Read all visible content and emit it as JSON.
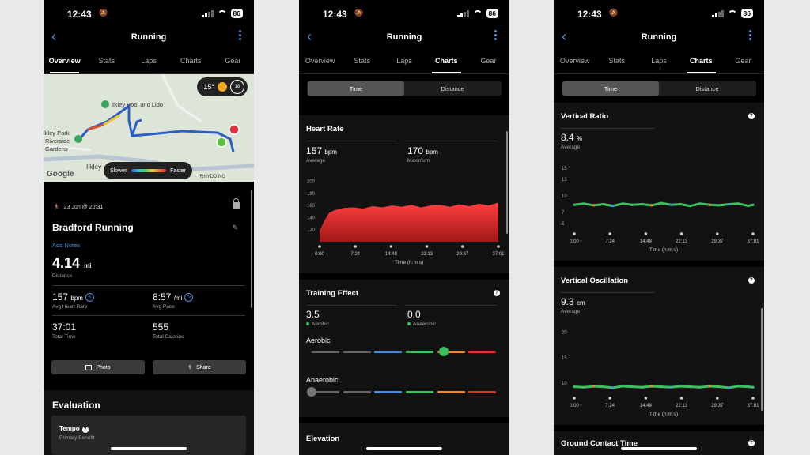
{
  "status": {
    "time": "12:43",
    "battery": "86"
  },
  "nav": {
    "title": "Running"
  },
  "tabs": [
    "Overview",
    "Stats",
    "Laps",
    "Charts",
    "Gear"
  ],
  "overview": {
    "map": {
      "weather_temp": "15°",
      "weather_badge": "18",
      "places": [
        "Ilkley Pool and Lido",
        "lkley Park",
        "Riverside",
        "Gardens",
        "Ilkley",
        "RHYDDING"
      ],
      "legend_slow": "Slower",
      "legend_fast": "Faster",
      "attribution": "Google"
    },
    "activity_date": "23 Jun @ 20:31",
    "activity_name": "Bradford Running",
    "add_notes": "Add Notes",
    "distance": {
      "value": "4.14",
      "unit": "mi",
      "label": "Distance"
    },
    "avg_hr": {
      "value": "157",
      "unit": "bpm",
      "label": "Avg Heart Rate"
    },
    "avg_pace": {
      "value": "8:57",
      "unit": "/mi",
      "label": "Avg Pace"
    },
    "total_time": {
      "value": "37:01",
      "label": "Total Time"
    },
    "total_calories": {
      "value": "555",
      "label": "Total Calories"
    },
    "photo_button": "Photo",
    "share_button": "Share",
    "evaluation": {
      "title": "Evaluation",
      "benefit": "Tempo",
      "benefit_label": "Primary Benefit"
    }
  },
  "charts_segment": {
    "time": "Time",
    "distance": "Distance"
  },
  "heart_rate": {
    "title": "Heart Rate",
    "average": {
      "value": "157",
      "unit": "bpm",
      "label": "Average"
    },
    "maximum": {
      "value": "170",
      "unit": "bpm",
      "label": "Maximum"
    }
  },
  "training_effect": {
    "title": "Training Effect",
    "aerobic": {
      "value": "3.5",
      "label": "Aerobic"
    },
    "anaerobic": {
      "value": "0.0",
      "label": "Anaerobic"
    },
    "aerobic_heading": "Aerobic",
    "anaerobic_heading": "Anaerobic",
    "scale_colors": [
      "#666666",
      "#666666",
      "#4a8fe0",
      "#3cc060",
      "#f08a30",
      "#e03030"
    ]
  },
  "elevation": {
    "title": "Elevation"
  },
  "vertical_ratio": {
    "title": "Vertical Ratio",
    "value": "8.4",
    "unit": "%",
    "label": "Average"
  },
  "vertical_oscillation": {
    "title": "Vertical Oscillation",
    "value": "9.3",
    "unit": "cm",
    "label": "Average"
  },
  "ground_contact": {
    "title": "Ground Contact Time"
  },
  "chart_data": [
    {
      "type": "area",
      "title": "Heart Rate",
      "xlabel": "Time (h:m:s)",
      "x_ticks": [
        "0:00",
        "7:24",
        "14:48",
        "22:13",
        "29:37",
        "37:01"
      ],
      "y_ticks": [
        120,
        140,
        160,
        180,
        200
      ],
      "ylim": [
        100,
        210
      ],
      "x": [
        0,
        1,
        2,
        3,
        5,
        7,
        9,
        11,
        13,
        15,
        17,
        19,
        21,
        23,
        25,
        27,
        29,
        31,
        33,
        35,
        37
      ],
      "values": [
        118,
        135,
        148,
        152,
        156,
        157,
        155,
        159,
        157,
        160,
        158,
        161,
        157,
        160,
        161,
        158,
        162,
        159,
        163,
        160,
        165
      ],
      "color": "#e03030"
    },
    {
      "type": "scatter",
      "title": "Vertical Ratio",
      "xlabel": "Time (h:m:s)",
      "x_ticks": [
        "0:00",
        "7:24",
        "14:48",
        "22:13",
        "29:37",
        "37:01"
      ],
      "y_ticks": [
        5,
        7,
        10,
        13,
        15
      ],
      "ylim": [
        4,
        16
      ],
      "x": [
        0,
        2,
        4,
        6,
        8,
        10,
        12,
        14,
        16,
        18,
        20,
        22,
        24,
        26,
        28,
        30,
        32,
        34,
        36,
        37
      ],
      "values": [
        8.4,
        8.6,
        8.3,
        8.5,
        8.2,
        8.6,
        8.4,
        8.5,
        8.3,
        8.7,
        8.4,
        8.5,
        8.2,
        8.6,
        8.4,
        8.3,
        8.5,
        8.6,
        8.2,
        8.4
      ]
    },
    {
      "type": "scatter",
      "title": "Vertical Oscillation",
      "xlabel": "Time (h:m:s)",
      "x_ticks": [
        "0:00",
        "7:24",
        "14:48",
        "22:13",
        "29:37",
        "37:01"
      ],
      "y_ticks": [
        10,
        15,
        20
      ],
      "ylim": [
        8,
        21
      ],
      "x": [
        0,
        2,
        4,
        6,
        8,
        10,
        12,
        14,
        16,
        18,
        20,
        22,
        24,
        26,
        28,
        30,
        32,
        34,
        36,
        37
      ],
      "values": [
        9.3,
        9.2,
        9.4,
        9.3,
        9.1,
        9.4,
        9.3,
        9.2,
        9.4,
        9.3,
        9.2,
        9.4,
        9.3,
        9.2,
        9.4,
        9.3,
        9.1,
        9.4,
        9.3,
        9.2
      ]
    }
  ]
}
